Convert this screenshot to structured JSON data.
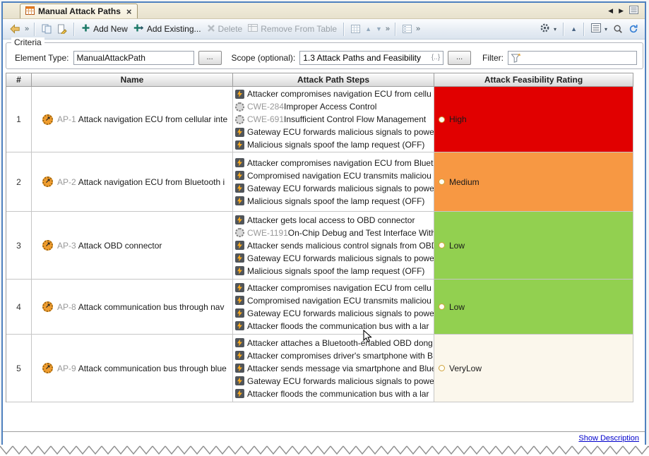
{
  "tab_bar": {
    "title": "Manual Attack Paths",
    "close_glyph": "×",
    "prev_glyph": "◀",
    "next_glyph": "▶"
  },
  "toolbar": {
    "overflow_glyph": "»",
    "caret_glyph": "▾",
    "collapse_glyph": "▲",
    "move_up_glyph": "▲",
    "move_down_glyph": "▼",
    "add_new": "Add New",
    "add_existing": "Add Existing...",
    "delete": "Delete",
    "remove_from_table": "Remove From Table"
  },
  "criteria": {
    "legend": "Criteria",
    "element_type_label": "Element Type:",
    "element_type_value": "ManualAttackPath",
    "element_type_browse": "...",
    "scope_label": "Scope (optional):",
    "scope_value": "1.3 Attack Paths and Feasibility",
    "scope_badge": "{..}",
    "scope_browse": "...",
    "filter_label": "Filter:"
  },
  "table": {
    "columns": [
      "#",
      "Name",
      "Attack Path Steps",
      "Attack Feasibility Rating"
    ],
    "rows": [
      {
        "num": "1",
        "id": "AP-1",
        "name": "Attack navigation ECU from cellular inte",
        "steps": [
          {
            "text": "Attacker compromises navigation ECU from cellu"
          },
          {
            "prefix": "CWE-284",
            "text": " Improper Access Control"
          },
          {
            "prefix": "CWE-691",
            "text": " Insufficient Control Flow Management"
          },
          {
            "text": "Gateway ECU forwards malicious signals to power"
          },
          {
            "text": "Malicious signals spoof the lamp request (OFF)"
          }
        ],
        "rating": "High",
        "rating_style": "background:#e10000"
      },
      {
        "num": "2",
        "id": "AP-2",
        "name": "Attack navigation ECU from Bluetooth i",
        "steps": [
          {
            "text": "Attacker compromises navigation ECU from Bluet"
          },
          {
            "text": "Compromised navigation ECU transmits maliciou"
          },
          {
            "text": "Gateway ECU forwards malicious signals to power"
          },
          {
            "text": "Malicious signals spoof the lamp request (OFF)"
          }
        ],
        "rating": "Medium",
        "rating_style": "background:#f79843"
      },
      {
        "num": "3",
        "id": "AP-3",
        "name": "Attack OBD connector",
        "steps": [
          {
            "text": "Attacker gets local access to OBD connector"
          },
          {
            "prefix": "CWE-1191",
            "text": " On-Chip Debug and Test Interface With"
          },
          {
            "text": "Attacker sends malicious control signals from OBD"
          },
          {
            "text": "Gateway ECU forwards malicious signals to power"
          },
          {
            "text": "Malicious signals spoof the lamp request (OFF)"
          }
        ],
        "rating": "Low",
        "rating_style": "background:#92d050"
      },
      {
        "num": "4",
        "id": "AP-8",
        "name": "Attack communication bus through nav",
        "steps": [
          {
            "text": "Attacker compromises navigation ECU from cellu"
          },
          {
            "text": "Compromised navigation ECU transmits maliciou"
          },
          {
            "text": "Gateway ECU forwards malicious signals to power"
          },
          {
            "text": "Attacker floods the communication bus with a lar"
          }
        ],
        "rating": "Low",
        "rating_style": "background:#92d050"
      },
      {
        "num": "5",
        "id": "AP-9",
        "name": "Attack communication bus through blue",
        "steps": [
          {
            "text": "Attacker attaches a Bluetooth-enabled OBD dong"
          },
          {
            "text": "Attacker compromises driver's smartphone with B"
          },
          {
            "text": "Attacker sends message via smartphone and Blue"
          },
          {
            "text": "Gateway ECU forwards malicious signals to power"
          },
          {
            "text": "Attacker floods the communication bus with a lar"
          }
        ],
        "rating": "VeryLow",
        "rating_style": "background:#fbf7ec"
      }
    ]
  },
  "footer": {
    "show_description": "Show Description"
  }
}
